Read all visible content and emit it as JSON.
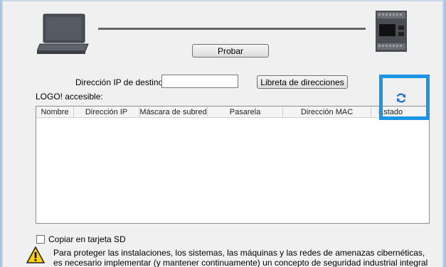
{
  "connection": {
    "test_button": "Probar"
  },
  "target": {
    "ip_label": "Dirección IP de destino:",
    "ip_value": "",
    "address_book_button": "Libreta de direcciones"
  },
  "accessible": {
    "label": "LOGO! accesible:",
    "columns": [
      "Nombre",
      "Dirección IP",
      "Máscara de subred",
      "Pasarela",
      "Dirección MAC",
      "Estado"
    ],
    "rows": []
  },
  "options": {
    "copy_sd_label": "Copiar en tarjeta SD",
    "copy_sd_checked": false
  },
  "warning": {
    "line1": "Para proteger las instalaciones, los sistemas, las máquinas y las redes de amenazas cibernéticas,",
    "line2": "es necesario implementar (y mantener continuamente) un concepto de seguridad industrial integral"
  },
  "colors": {
    "highlight": "#1a95e6",
    "refresh_icon": "#1a6fd0"
  },
  "icons": {
    "laptop": "laptop-icon",
    "device": "logo-device-icon",
    "refresh": "refresh-icon",
    "warning": "warning-icon"
  }
}
